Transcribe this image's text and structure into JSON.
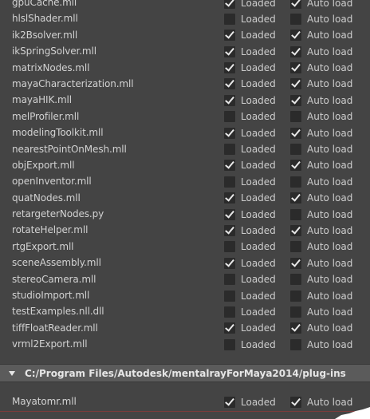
{
  "option_labels": {
    "loaded": "Loaded",
    "autoload": "Auto load"
  },
  "plugins": [
    {
      "name": "gpuCache.mll",
      "loaded": true,
      "autoload": true
    },
    {
      "name": "hlslShader.mll",
      "loaded": false,
      "autoload": false
    },
    {
      "name": "ik2Bsolver.mll",
      "loaded": true,
      "autoload": true
    },
    {
      "name": "ikSpringSolver.mll",
      "loaded": true,
      "autoload": true
    },
    {
      "name": "matrixNodes.mll",
      "loaded": true,
      "autoload": true
    },
    {
      "name": "mayaCharacterization.mll",
      "loaded": true,
      "autoload": true
    },
    {
      "name": "mayaHIK.mll",
      "loaded": true,
      "autoload": true
    },
    {
      "name": "melProfiler.mll",
      "loaded": false,
      "autoload": false
    },
    {
      "name": "modelingToolkit.mll",
      "loaded": true,
      "autoload": true
    },
    {
      "name": "nearestPointOnMesh.mll",
      "loaded": false,
      "autoload": false
    },
    {
      "name": "objExport.mll",
      "loaded": true,
      "autoload": true
    },
    {
      "name": "openInventor.mll",
      "loaded": false,
      "autoload": false
    },
    {
      "name": "quatNodes.mll",
      "loaded": true,
      "autoload": true
    },
    {
      "name": "retargeterNodes.py",
      "loaded": true,
      "autoload": false
    },
    {
      "name": "rotateHelper.mll",
      "loaded": true,
      "autoload": true
    },
    {
      "name": "rtgExport.mll",
      "loaded": false,
      "autoload": false
    },
    {
      "name": "sceneAssembly.mll",
      "loaded": true,
      "autoload": true
    },
    {
      "name": "stereoCamera.mll",
      "loaded": false,
      "autoload": false
    },
    {
      "name": "studioImport.mll",
      "loaded": false,
      "autoload": false
    },
    {
      "name": "testExamples.nll.dll",
      "loaded": false,
      "autoload": false
    },
    {
      "name": "tiffFloatReader.mll",
      "loaded": true,
      "autoload": true
    },
    {
      "name": "vrml2Export.mll",
      "loaded": false,
      "autoload": false
    }
  ],
  "section": {
    "path": "C:/Program Files/Autodesk/mentalrayForMaya2014/plug-ins",
    "plugins": [
      {
        "name": "Mayatomr.mll",
        "loaded": true,
        "autoload": true
      }
    ]
  },
  "colors": {
    "background": "#444444",
    "checkbox": "#2b2b2b",
    "section_header": "#5b5b5b",
    "text": "#cfcfcf"
  }
}
